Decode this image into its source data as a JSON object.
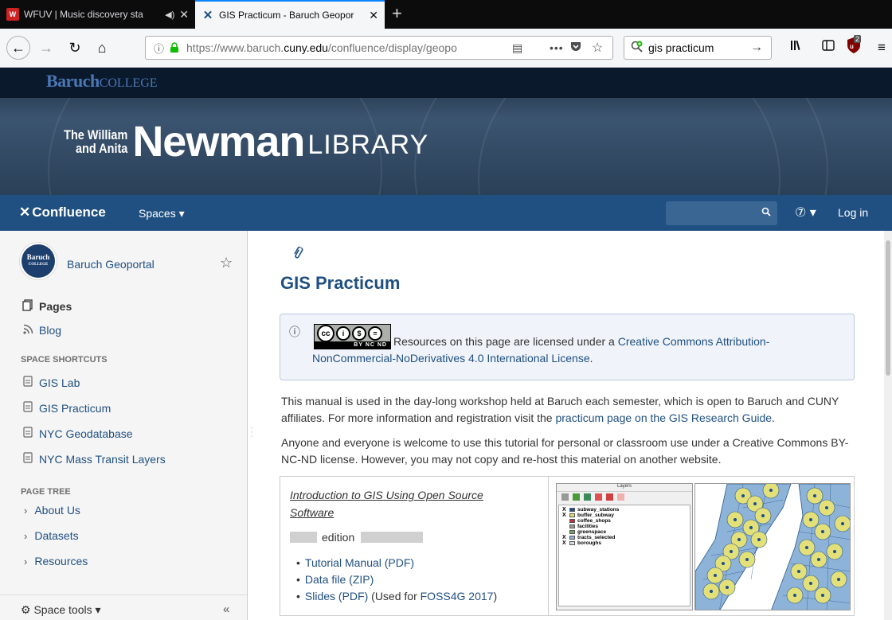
{
  "browser": {
    "tabs": [
      {
        "title": "WFUV | Music discovery sta",
        "audio": "◀)",
        "close": "✕"
      },
      {
        "title": "GIS Practicum - Baruch Geopor",
        "close": "✕"
      }
    ],
    "new_tab": "+",
    "url_prefix": "https://www.baruch.",
    "url_domain": "cuny.edu",
    "url_suffix": "/confluence/display/geopo",
    "search_value": "gis practicum"
  },
  "banner": {
    "logo_main": "Baruch",
    "logo_sub": "COLLEGE",
    "the_william": "The William",
    "and_anita": "and Anita",
    "newman": "Newman",
    "library": "LIBRARY"
  },
  "conf_header": {
    "logo": "Confluence",
    "spaces": "Spaces ▾",
    "help": "⑦ ▾",
    "login": "Log in"
  },
  "sidebar": {
    "avatar_line1": "Baruch",
    "avatar_line2": "COLLEGE",
    "space_name": "Baruch Geoportal",
    "pages": "Pages",
    "blog": "Blog",
    "shortcuts_heading": "SPACE SHORTCUTS",
    "shortcuts": [
      "GIS Lab",
      "GIS Practicum",
      "NYC Geodatabase",
      "NYC Mass Transit Layers"
    ],
    "tree_heading": "PAGE TREE",
    "tree": [
      "About Us",
      "Datasets",
      "Resources"
    ],
    "space_tools": "Space tools ▾",
    "collapse": "«"
  },
  "main": {
    "title": "GIS Practicum",
    "cc_badge_text": "BY  NC  ND",
    "license_pre": "Resources on this page are licensed under a ",
    "license_link": "Creative Commons Attribution-NonCommercial-NoDerivatives 4.0 International License",
    "license_post": ".",
    "p1_text": " This manual is used in the day-long workshop held at Baruch each semester, which is open to Baruch and CUNY affiliates. For more information and registration visit the ",
    "p1_link": "practicum page on the GIS Research Guide",
    "p1_end": ".",
    "p2_text": "Anyone and everyone is welcome to use this tutorial for personal or classroom use under a Creative Commons BY-NC-ND license. However, you may not copy and re-host this material on another website.",
    "table_title": "Introduction to GIS Using Open Source Software",
    "edition_label": "edition",
    "links": [
      {
        "label": "Tutorial Manual (PDF)",
        "suffix": ""
      },
      {
        "label": "Data file (ZIP)",
        "suffix": ""
      },
      {
        "label": "Slides (PDF)",
        "suffix": " (Used for "
      }
    ],
    "foss_link": "FOSS4G 2017",
    "foss_end": ")",
    "qgis": {
      "panel_title": "Layers",
      "layers": [
        {
          "name": "subway_stations",
          "checked": true,
          "color": "#1a4f8a"
        },
        {
          "name": "buffer_subway",
          "checked": true,
          "color": "#e3e07a"
        },
        {
          "name": "coffee_shops",
          "checked": false,
          "color": "#c0303c"
        },
        {
          "name": "facilities",
          "checked": false,
          "color": "#999999"
        },
        {
          "name": "greenspace",
          "checked": false,
          "color": "#6aaa5a"
        },
        {
          "name": "tracts_selected",
          "checked": true,
          "color": "#8db3d9"
        },
        {
          "name": "boroughs",
          "checked": true,
          "color": "#dddddd"
        }
      ]
    }
  }
}
